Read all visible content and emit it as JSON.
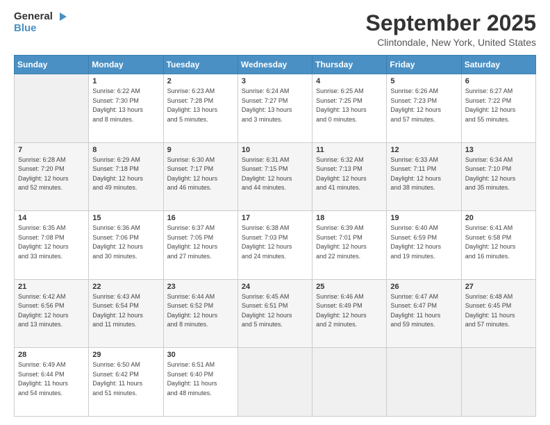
{
  "logo": {
    "line1": "General",
    "line2": "Blue"
  },
  "title": "September 2025",
  "subtitle": "Clintondale, New York, United States",
  "headers": [
    "Sunday",
    "Monday",
    "Tuesday",
    "Wednesday",
    "Thursday",
    "Friday",
    "Saturday"
  ],
  "weeks": [
    [
      {
        "day": "",
        "info": ""
      },
      {
        "day": "1",
        "info": "Sunrise: 6:22 AM\nSunset: 7:30 PM\nDaylight: 13 hours\nand 8 minutes."
      },
      {
        "day": "2",
        "info": "Sunrise: 6:23 AM\nSunset: 7:28 PM\nDaylight: 13 hours\nand 5 minutes."
      },
      {
        "day": "3",
        "info": "Sunrise: 6:24 AM\nSunset: 7:27 PM\nDaylight: 13 hours\nand 3 minutes."
      },
      {
        "day": "4",
        "info": "Sunrise: 6:25 AM\nSunset: 7:25 PM\nDaylight: 13 hours\nand 0 minutes."
      },
      {
        "day": "5",
        "info": "Sunrise: 6:26 AM\nSunset: 7:23 PM\nDaylight: 12 hours\nand 57 minutes."
      },
      {
        "day": "6",
        "info": "Sunrise: 6:27 AM\nSunset: 7:22 PM\nDaylight: 12 hours\nand 55 minutes."
      }
    ],
    [
      {
        "day": "7",
        "info": "Sunrise: 6:28 AM\nSunset: 7:20 PM\nDaylight: 12 hours\nand 52 minutes."
      },
      {
        "day": "8",
        "info": "Sunrise: 6:29 AM\nSunset: 7:18 PM\nDaylight: 12 hours\nand 49 minutes."
      },
      {
        "day": "9",
        "info": "Sunrise: 6:30 AM\nSunset: 7:17 PM\nDaylight: 12 hours\nand 46 minutes."
      },
      {
        "day": "10",
        "info": "Sunrise: 6:31 AM\nSunset: 7:15 PM\nDaylight: 12 hours\nand 44 minutes."
      },
      {
        "day": "11",
        "info": "Sunrise: 6:32 AM\nSunset: 7:13 PM\nDaylight: 12 hours\nand 41 minutes."
      },
      {
        "day": "12",
        "info": "Sunrise: 6:33 AM\nSunset: 7:11 PM\nDaylight: 12 hours\nand 38 minutes."
      },
      {
        "day": "13",
        "info": "Sunrise: 6:34 AM\nSunset: 7:10 PM\nDaylight: 12 hours\nand 35 minutes."
      }
    ],
    [
      {
        "day": "14",
        "info": "Sunrise: 6:35 AM\nSunset: 7:08 PM\nDaylight: 12 hours\nand 33 minutes."
      },
      {
        "day": "15",
        "info": "Sunrise: 6:36 AM\nSunset: 7:06 PM\nDaylight: 12 hours\nand 30 minutes."
      },
      {
        "day": "16",
        "info": "Sunrise: 6:37 AM\nSunset: 7:05 PM\nDaylight: 12 hours\nand 27 minutes."
      },
      {
        "day": "17",
        "info": "Sunrise: 6:38 AM\nSunset: 7:03 PM\nDaylight: 12 hours\nand 24 minutes."
      },
      {
        "day": "18",
        "info": "Sunrise: 6:39 AM\nSunset: 7:01 PM\nDaylight: 12 hours\nand 22 minutes."
      },
      {
        "day": "19",
        "info": "Sunrise: 6:40 AM\nSunset: 6:59 PM\nDaylight: 12 hours\nand 19 minutes."
      },
      {
        "day": "20",
        "info": "Sunrise: 6:41 AM\nSunset: 6:58 PM\nDaylight: 12 hours\nand 16 minutes."
      }
    ],
    [
      {
        "day": "21",
        "info": "Sunrise: 6:42 AM\nSunset: 6:56 PM\nDaylight: 12 hours\nand 13 minutes."
      },
      {
        "day": "22",
        "info": "Sunrise: 6:43 AM\nSunset: 6:54 PM\nDaylight: 12 hours\nand 11 minutes."
      },
      {
        "day": "23",
        "info": "Sunrise: 6:44 AM\nSunset: 6:52 PM\nDaylight: 12 hours\nand 8 minutes."
      },
      {
        "day": "24",
        "info": "Sunrise: 6:45 AM\nSunset: 6:51 PM\nDaylight: 12 hours\nand 5 minutes."
      },
      {
        "day": "25",
        "info": "Sunrise: 6:46 AM\nSunset: 6:49 PM\nDaylight: 12 hours\nand 2 minutes."
      },
      {
        "day": "26",
        "info": "Sunrise: 6:47 AM\nSunset: 6:47 PM\nDaylight: 11 hours\nand 59 minutes."
      },
      {
        "day": "27",
        "info": "Sunrise: 6:48 AM\nSunset: 6:45 PM\nDaylight: 11 hours\nand 57 minutes."
      }
    ],
    [
      {
        "day": "28",
        "info": "Sunrise: 6:49 AM\nSunset: 6:44 PM\nDaylight: 11 hours\nand 54 minutes."
      },
      {
        "day": "29",
        "info": "Sunrise: 6:50 AM\nSunset: 6:42 PM\nDaylight: 11 hours\nand 51 minutes."
      },
      {
        "day": "30",
        "info": "Sunrise: 6:51 AM\nSunset: 6:40 PM\nDaylight: 11 hours\nand 48 minutes."
      },
      {
        "day": "",
        "info": ""
      },
      {
        "day": "",
        "info": ""
      },
      {
        "day": "",
        "info": ""
      },
      {
        "day": "",
        "info": ""
      }
    ]
  ]
}
